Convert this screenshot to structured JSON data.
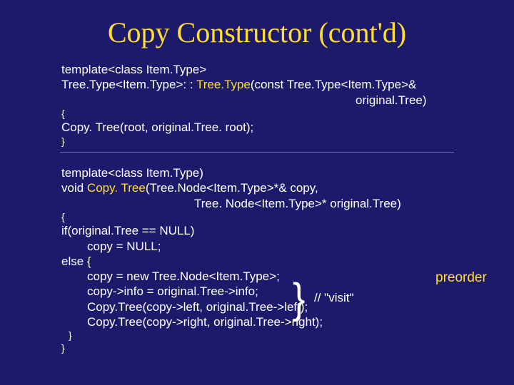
{
  "title": "Copy Constructor (cont'd)",
  "block1": {
    "l1": "template<class Item.Type>",
    "l2a": "Tree.Type<Item.Type>: : ",
    "l2b": "Tree.Type",
    "l2c": "(const Tree.Type<Item.Type>&",
    "l3": "original.Tree)",
    "l4": "{",
    "l5": " Copy. Tree(root, original.Tree. root);",
    "l6": "}"
  },
  "block2": {
    "l1": "template<class Item.Type)",
    "l2a": "void ",
    "l2b": "Copy. Tree",
    "l2c": "(Tree.Node<Item.Type>*& copy,",
    "l3": "Tree. Node<Item.Type>* original.Tree)",
    "l4": "{",
    "l5": " if(original.Tree == NULL)",
    "l6": "copy = NULL;",
    "l7": " else {",
    "l8": "copy = new Tree.Node<Item.Type>;",
    "l9": "copy->info = original.Tree->info;",
    "l10": "Copy.Tree(copy->left, original.Tree->left);",
    "l11": "Copy.Tree(copy->right, original.Tree->right);",
    "l12": "}",
    "l13": "}"
  },
  "annotations": {
    "visit": "// \"visit\"",
    "preorder": "preorder"
  }
}
